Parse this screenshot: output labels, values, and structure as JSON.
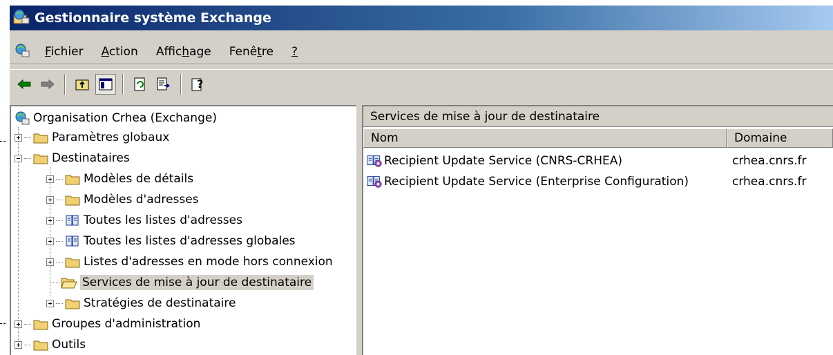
{
  "window": {
    "title": "Gestionnaire système Exchange"
  },
  "menu": {
    "items": [
      {
        "pre": "",
        "key": "F",
        "post": "ichier"
      },
      {
        "pre": "",
        "key": "A",
        "post": "ction"
      },
      {
        "pre": "Affic",
        "key": "h",
        "post": "age"
      },
      {
        "pre": "Fenê",
        "key": "t",
        "post": "re"
      },
      {
        "pre": "",
        "key": "?",
        "post": ""
      }
    ]
  },
  "tree": {
    "root": "Organisation Crhea (Exchange)",
    "items": [
      {
        "label": "Paramètres globaux"
      },
      {
        "label": "Destinataires"
      },
      {
        "label": "Modèles de détails"
      },
      {
        "label": "Modèles d'adresses"
      },
      {
        "label": "Toutes les listes d'adresses"
      },
      {
        "label": "Toutes les listes d'adresses globales"
      },
      {
        "label": "Listes d'adresses en mode hors connexion"
      },
      {
        "label": "Services de mise à jour de destinataire"
      },
      {
        "label": "Stratégies de destinataire"
      },
      {
        "label": "Groupes d'administration"
      },
      {
        "label": "Outils"
      }
    ]
  },
  "details": {
    "header": "Services de mise à jour de destinataire",
    "columns": {
      "name": "Nom",
      "domain": "Domaine"
    },
    "rows": [
      {
        "name": "Recipient Update Service (CNRS-CRHEA)",
        "domain": "crhea.cnrs.fr"
      },
      {
        "name": "Recipient Update Service (Enterprise Configuration)",
        "domain": "crhea.cnrs.fr"
      }
    ]
  }
}
